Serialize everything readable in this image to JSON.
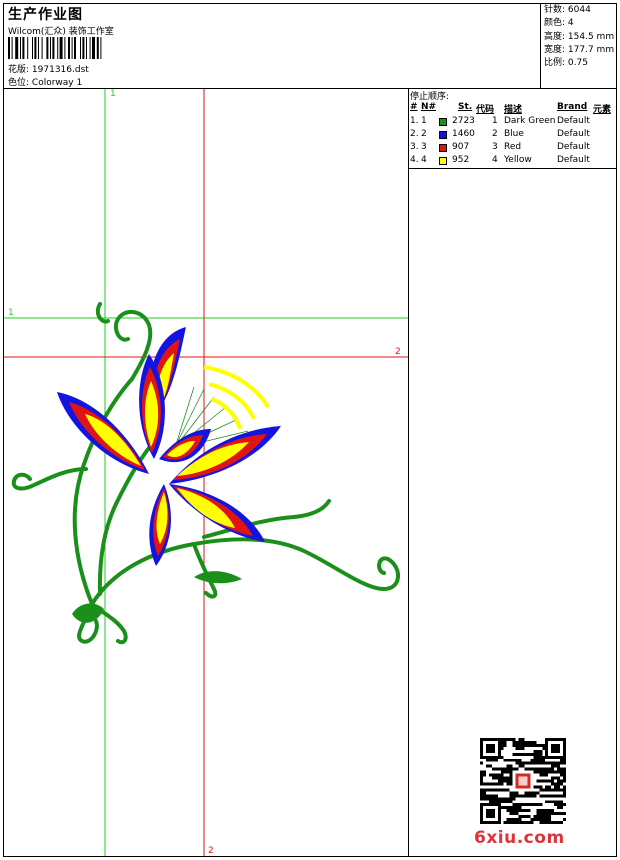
{
  "header": {
    "title": "生产作业图",
    "subtitle": "Wilcom(汇众) 装饰工作室",
    "design_label": "花版:",
    "design_value": "1971316.dst",
    "colorway_label": "色位:",
    "colorway_value": "Colorway 1"
  },
  "stats": [
    {
      "label": "针数:",
      "value": "6044"
    },
    {
      "label": "颜色:",
      "value": "4"
    },
    {
      "label": "高度:",
      "value": "154.5 mm"
    },
    {
      "label": "宽度:",
      "value": "177.7 mm"
    },
    {
      "label": "比例:",
      "value": "0.75"
    }
  ],
  "stop_sequence": {
    "title": "停止顺序:",
    "columns": [
      "#",
      "N#",
      "St.",
      "代码",
      "描述",
      "Brand",
      "元素"
    ],
    "rows": [
      {
        "index": "1.",
        "n": "1",
        "color": "#1a8f1a",
        "stitches": "2723",
        "code": "1",
        "description": "Dark Green",
        "brand": "Default"
      },
      {
        "index": "2.",
        "n": "2",
        "color": "#1414e0",
        "stitches": "1460",
        "code": "2",
        "description": "Blue",
        "brand": "Default"
      },
      {
        "index": "3.",
        "n": "3",
        "color": "#e01414",
        "stitches": "907",
        "code": "3",
        "description": "Red",
        "brand": "Default"
      },
      {
        "index": "4.",
        "n": "4",
        "color": "#ffff00",
        "stitches": "952",
        "code": "4",
        "description": "Yellow",
        "brand": "Default"
      }
    ]
  },
  "axes": {
    "green_top": "1",
    "green_left": "1",
    "red_right": "2",
    "red_bottom": "2"
  },
  "brand": "6xiu.com",
  "colors": {
    "green_line": "#22cc22",
    "red_line": "#e01414",
    "thread_green": "#1a8f1a",
    "thread_blue": "#1414e0",
    "thread_red": "#e01414",
    "thread_yellow": "#ffff00"
  }
}
